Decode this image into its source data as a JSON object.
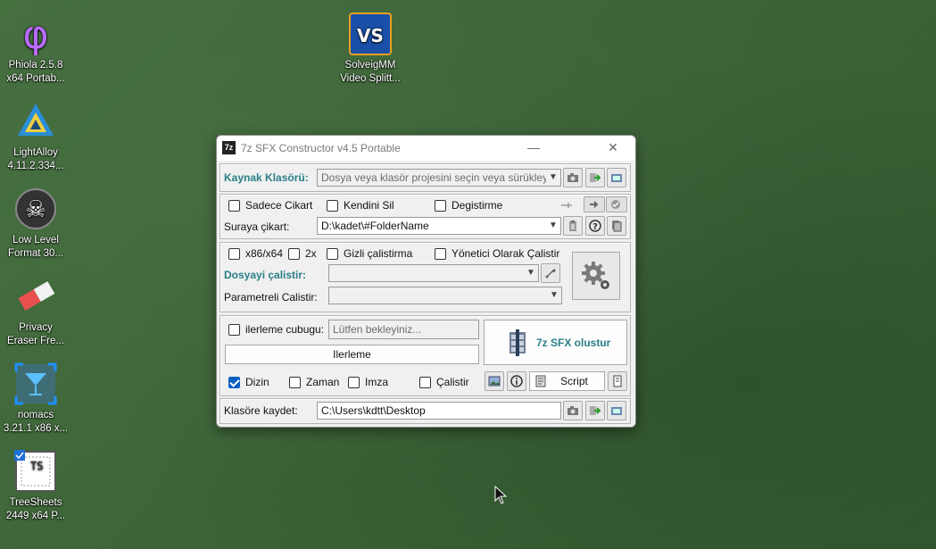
{
  "desktop": {
    "icons": [
      {
        "line1": "Phiola 2.5.8",
        "line2": "x64 Portab..."
      },
      {
        "line1": "LightAlloy",
        "line2": "4.11.2.334..."
      },
      {
        "line1": "Low Level",
        "line2": "Format 30..."
      },
      {
        "line1": "Privacy",
        "line2": "Eraser Fre..."
      },
      {
        "line1": "nomacs",
        "line2": "3.21.1 x86 x..."
      },
      {
        "line1": "TreeSheets",
        "line2": "2449 x64 P..."
      },
      {
        "line1": "SolveigMM",
        "line2": "Video Splitt..."
      }
    ]
  },
  "window": {
    "app_icon_text": "7z",
    "title": "7z SFX Constructor v4.5 Portable",
    "minimize": "—",
    "close": "✕"
  },
  "source": {
    "label": "Kaynak Klasörü:",
    "placeholder": "Dosya veya klasör projesini seçin veya sürükleyin"
  },
  "extract": {
    "options": [
      "Sadece Cikart",
      "Kendini Sil",
      "Degistirme"
    ],
    "path_label": "Suraya çikart:",
    "path_value": "D:\\kadet\\#FolderName"
  },
  "run": {
    "options": [
      "x86/x64",
      "2x",
      "Gizli çalistirma",
      "Yönetici Olarak Çalistir"
    ],
    "file_label": "Dosyayi çalistir:",
    "param_label": "Parametreli Calistir:"
  },
  "progress": {
    "checkbox_label": "ilerleme cubugu:",
    "input_placeholder": "Lütfen bekleyiniz...",
    "button_label": "Ilerleme",
    "create_label": "7z SFX olustur",
    "options": [
      {
        "label": "Dizin",
        "checked": true
      },
      {
        "label": "Zaman",
        "checked": false
      },
      {
        "label": "Imza",
        "checked": false
      },
      {
        "label": "Çalistir",
        "checked": false
      }
    ],
    "script_label": "Script"
  },
  "save": {
    "label": "Klasöre kaydet:",
    "path_value": "C:\\Users\\kdtt\\Desktop"
  },
  "colors": {
    "accent": "#2a7f87",
    "checkbox": "#0a5fc2"
  }
}
